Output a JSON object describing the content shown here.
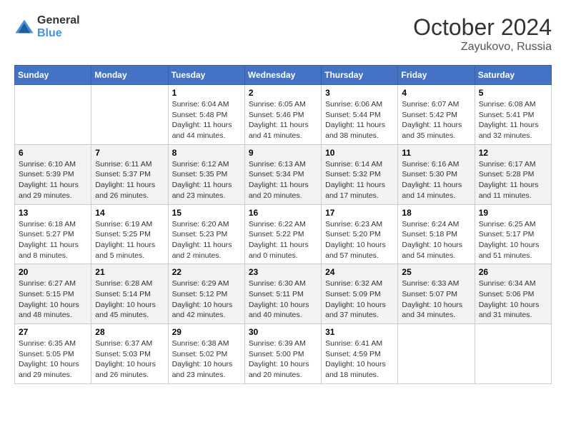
{
  "header": {
    "logo_general": "General",
    "logo_blue": "Blue",
    "month_title": "October 2024",
    "location": "Zayukovo, Russia"
  },
  "weekdays": [
    "Sunday",
    "Monday",
    "Tuesday",
    "Wednesday",
    "Thursday",
    "Friday",
    "Saturday"
  ],
  "weeks": [
    [
      {
        "day": "",
        "info": ""
      },
      {
        "day": "",
        "info": ""
      },
      {
        "day": "1",
        "info": "Sunrise: 6:04 AM\nSunset: 5:48 PM\nDaylight: 11 hours and 44 minutes."
      },
      {
        "day": "2",
        "info": "Sunrise: 6:05 AM\nSunset: 5:46 PM\nDaylight: 11 hours and 41 minutes."
      },
      {
        "day": "3",
        "info": "Sunrise: 6:06 AM\nSunset: 5:44 PM\nDaylight: 11 hours and 38 minutes."
      },
      {
        "day": "4",
        "info": "Sunrise: 6:07 AM\nSunset: 5:42 PM\nDaylight: 11 hours and 35 minutes."
      },
      {
        "day": "5",
        "info": "Sunrise: 6:08 AM\nSunset: 5:41 PM\nDaylight: 11 hours and 32 minutes."
      }
    ],
    [
      {
        "day": "6",
        "info": "Sunrise: 6:10 AM\nSunset: 5:39 PM\nDaylight: 11 hours and 29 minutes."
      },
      {
        "day": "7",
        "info": "Sunrise: 6:11 AM\nSunset: 5:37 PM\nDaylight: 11 hours and 26 minutes."
      },
      {
        "day": "8",
        "info": "Sunrise: 6:12 AM\nSunset: 5:35 PM\nDaylight: 11 hours and 23 minutes."
      },
      {
        "day": "9",
        "info": "Sunrise: 6:13 AM\nSunset: 5:34 PM\nDaylight: 11 hours and 20 minutes."
      },
      {
        "day": "10",
        "info": "Sunrise: 6:14 AM\nSunset: 5:32 PM\nDaylight: 11 hours and 17 minutes."
      },
      {
        "day": "11",
        "info": "Sunrise: 6:16 AM\nSunset: 5:30 PM\nDaylight: 11 hours and 14 minutes."
      },
      {
        "day": "12",
        "info": "Sunrise: 6:17 AM\nSunset: 5:28 PM\nDaylight: 11 hours and 11 minutes."
      }
    ],
    [
      {
        "day": "13",
        "info": "Sunrise: 6:18 AM\nSunset: 5:27 PM\nDaylight: 11 hours and 8 minutes."
      },
      {
        "day": "14",
        "info": "Sunrise: 6:19 AM\nSunset: 5:25 PM\nDaylight: 11 hours and 5 minutes."
      },
      {
        "day": "15",
        "info": "Sunrise: 6:20 AM\nSunset: 5:23 PM\nDaylight: 11 hours and 2 minutes."
      },
      {
        "day": "16",
        "info": "Sunrise: 6:22 AM\nSunset: 5:22 PM\nDaylight: 11 hours and 0 minutes."
      },
      {
        "day": "17",
        "info": "Sunrise: 6:23 AM\nSunset: 5:20 PM\nDaylight: 10 hours and 57 minutes."
      },
      {
        "day": "18",
        "info": "Sunrise: 6:24 AM\nSunset: 5:18 PM\nDaylight: 10 hours and 54 minutes."
      },
      {
        "day": "19",
        "info": "Sunrise: 6:25 AM\nSunset: 5:17 PM\nDaylight: 10 hours and 51 minutes."
      }
    ],
    [
      {
        "day": "20",
        "info": "Sunrise: 6:27 AM\nSunset: 5:15 PM\nDaylight: 10 hours and 48 minutes."
      },
      {
        "day": "21",
        "info": "Sunrise: 6:28 AM\nSunset: 5:14 PM\nDaylight: 10 hours and 45 minutes."
      },
      {
        "day": "22",
        "info": "Sunrise: 6:29 AM\nSunset: 5:12 PM\nDaylight: 10 hours and 42 minutes."
      },
      {
        "day": "23",
        "info": "Sunrise: 6:30 AM\nSunset: 5:11 PM\nDaylight: 10 hours and 40 minutes."
      },
      {
        "day": "24",
        "info": "Sunrise: 6:32 AM\nSunset: 5:09 PM\nDaylight: 10 hours and 37 minutes."
      },
      {
        "day": "25",
        "info": "Sunrise: 6:33 AM\nSunset: 5:07 PM\nDaylight: 10 hours and 34 minutes."
      },
      {
        "day": "26",
        "info": "Sunrise: 6:34 AM\nSunset: 5:06 PM\nDaylight: 10 hours and 31 minutes."
      }
    ],
    [
      {
        "day": "27",
        "info": "Sunrise: 6:35 AM\nSunset: 5:05 PM\nDaylight: 10 hours and 29 minutes."
      },
      {
        "day": "28",
        "info": "Sunrise: 6:37 AM\nSunset: 5:03 PM\nDaylight: 10 hours and 26 minutes."
      },
      {
        "day": "29",
        "info": "Sunrise: 6:38 AM\nSunset: 5:02 PM\nDaylight: 10 hours and 23 minutes."
      },
      {
        "day": "30",
        "info": "Sunrise: 6:39 AM\nSunset: 5:00 PM\nDaylight: 10 hours and 20 minutes."
      },
      {
        "day": "31",
        "info": "Sunrise: 6:41 AM\nSunset: 4:59 PM\nDaylight: 10 hours and 18 minutes."
      },
      {
        "day": "",
        "info": ""
      },
      {
        "day": "",
        "info": ""
      }
    ]
  ]
}
